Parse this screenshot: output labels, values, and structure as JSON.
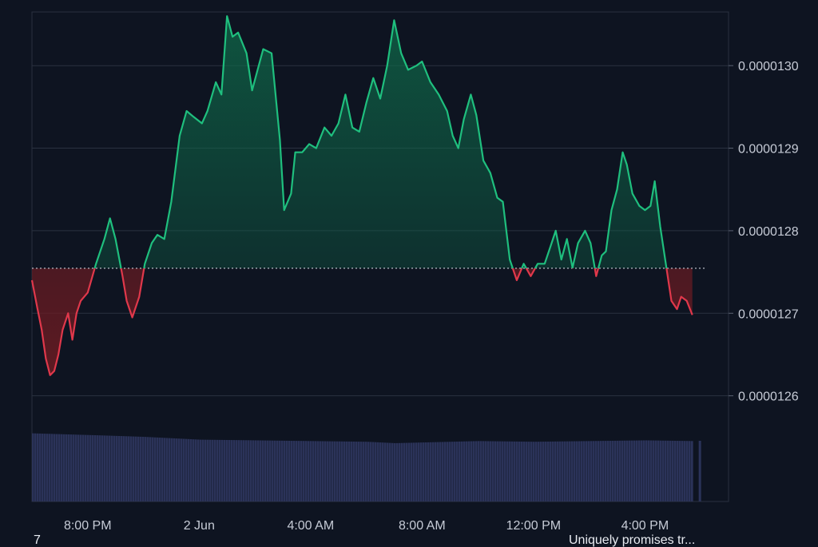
{
  "chart_data": {
    "type": "area",
    "baseline": 1.27545e-06,
    "ylim": [
      1.256e-06,
      1.3065e-06
    ],
    "x_ticks": [
      "8:00 PM",
      "2 Jun",
      "4:00 AM",
      "8:00 AM",
      "12:00 PM",
      "4:00 PM"
    ],
    "x_tick_positions_hours": [
      2,
      6,
      10,
      14,
      18,
      22
    ],
    "x_range_hours": [
      0,
      25
    ],
    "y_ticks": [
      1.26e-06,
      1.27e-06,
      1.28e-06,
      1.29e-06,
      1.3e-06
    ],
    "y_tick_labels": [
      "0.0000126",
      "0.0000127",
      "0.0000128",
      "0.0000129",
      "0.0000130"
    ],
    "grid": true,
    "price_series": [
      [
        0.0,
        1.274e-06
      ],
      [
        0.2,
        1.2705e-06
      ],
      [
        0.35,
        1.268e-06
      ],
      [
        0.5,
        1.2645e-06
      ],
      [
        0.65,
        1.2625e-06
      ],
      [
        0.8,
        1.263e-06
      ],
      [
        0.95,
        1.265e-06
      ],
      [
        1.1,
        1.268e-06
      ],
      [
        1.3,
        1.27e-06
      ],
      [
        1.45,
        1.2668e-06
      ],
      [
        1.6,
        1.27e-06
      ],
      [
        1.75,
        1.2715e-06
      ],
      [
        2.0,
        1.2725e-06
      ],
      [
        2.3,
        1.276e-06
      ],
      [
        2.6,
        1.279e-06
      ],
      [
        2.8,
        1.2815e-06
      ],
      [
        3.0,
        1.279e-06
      ],
      [
        3.25,
        1.2745e-06
      ],
      [
        3.4,
        1.2715e-06
      ],
      [
        3.6,
        1.2695e-06
      ],
      [
        3.85,
        1.272e-06
      ],
      [
        4.05,
        1.276e-06
      ],
      [
        4.3,
        1.2785e-06
      ],
      [
        4.5,
        1.2795e-06
      ],
      [
        4.75,
        1.279e-06
      ],
      [
        5.0,
        1.2835e-06
      ],
      [
        5.3,
        1.2915e-06
      ],
      [
        5.55,
        1.2945e-06
      ],
      [
        5.8,
        1.2938e-06
      ],
      [
        6.1,
        1.293e-06
      ],
      [
        6.3,
        1.2945e-06
      ],
      [
        6.6,
        1.298e-06
      ],
      [
        6.8,
        1.2965e-06
      ],
      [
        7.0,
        1.306e-06
      ],
      [
        7.2,
        1.3035e-06
      ],
      [
        7.4,
        1.304e-06
      ],
      [
        7.7,
        1.3015e-06
      ],
      [
        7.9,
        1.297e-06
      ],
      [
        8.1,
        1.2995e-06
      ],
      [
        8.3,
        1.302e-06
      ],
      [
        8.6,
        1.3015e-06
      ],
      [
        8.9,
        1.291e-06
      ],
      [
        9.05,
        1.2825e-06
      ],
      [
        9.3,
        1.2845e-06
      ],
      [
        9.45,
        1.2895e-06
      ],
      [
        9.7,
        1.2895e-06
      ],
      [
        9.95,
        1.2905e-06
      ],
      [
        10.2,
        1.29e-06
      ],
      [
        10.5,
        1.2925e-06
      ],
      [
        10.75,
        1.2915e-06
      ],
      [
        11.0,
        1.293e-06
      ],
      [
        11.25,
        1.2965e-06
      ],
      [
        11.5,
        1.2925e-06
      ],
      [
        11.75,
        1.292e-06
      ],
      [
        12.0,
        1.2955e-06
      ],
      [
        12.25,
        1.2985e-06
      ],
      [
        12.5,
        1.296e-06
      ],
      [
        12.75,
        1.3e-06
      ],
      [
        13.0,
        1.3055e-06
      ],
      [
        13.25,
        1.3015e-06
      ],
      [
        13.5,
        1.2995e-06
      ],
      [
        13.8,
        1.3e-06
      ],
      [
        14.0,
        1.3005e-06
      ],
      [
        14.3,
        1.298e-06
      ],
      [
        14.6,
        1.2965e-06
      ],
      [
        14.9,
        1.2945e-06
      ],
      [
        15.1,
        1.2915e-06
      ],
      [
        15.3,
        1.29e-06
      ],
      [
        15.5,
        1.2935e-06
      ],
      [
        15.75,
        1.2965e-06
      ],
      [
        15.95,
        1.294e-06
      ],
      [
        16.2,
        1.2885e-06
      ],
      [
        16.45,
        1.287e-06
      ],
      [
        16.7,
        1.284e-06
      ],
      [
        16.9,
        1.2835e-06
      ],
      [
        17.15,
        1.2765e-06
      ],
      [
        17.4,
        1.274e-06
      ],
      [
        17.65,
        1.276e-06
      ],
      [
        17.9,
        1.2745e-06
      ],
      [
        18.15,
        1.276e-06
      ],
      [
        18.4,
        1.276e-06
      ],
      [
        18.6,
        1.278e-06
      ],
      [
        18.8,
        1.28e-06
      ],
      [
        19.0,
        1.2765e-06
      ],
      [
        19.2,
        1.279e-06
      ],
      [
        19.4,
        1.2755e-06
      ],
      [
        19.6,
        1.2785e-06
      ],
      [
        19.85,
        1.28e-06
      ],
      [
        20.05,
        1.2785e-06
      ],
      [
        20.25,
        1.2745e-06
      ],
      [
        20.45,
        1.277e-06
      ],
      [
        20.6,
        1.2775e-06
      ],
      [
        20.8,
        1.2825e-06
      ],
      [
        21.0,
        1.285e-06
      ],
      [
        21.2,
        1.2895e-06
      ],
      [
        21.35,
        1.288e-06
      ],
      [
        21.55,
        1.2845e-06
      ],
      [
        21.8,
        1.283e-06
      ],
      [
        22.0,
        1.2825e-06
      ],
      [
        22.2,
        1.283e-06
      ],
      [
        22.35,
        1.286e-06
      ],
      [
        22.55,
        1.2805e-06
      ],
      [
        22.75,
        1.276e-06
      ],
      [
        22.95,
        1.2715e-06
      ],
      [
        23.15,
        1.2705e-06
      ],
      [
        23.3,
        1.272e-06
      ],
      [
        23.5,
        1.2715e-06
      ],
      [
        23.7,
        1.2698e-06
      ]
    ],
    "volume_series": [
      [
        0.0,
        0.97
      ],
      [
        2.5,
        0.94
      ],
      [
        4.0,
        0.92
      ],
      [
        6.0,
        0.88
      ],
      [
        8.0,
        0.87
      ],
      [
        10.0,
        0.86
      ],
      [
        12.0,
        0.85
      ],
      [
        13.0,
        0.83
      ],
      [
        14.0,
        0.84
      ],
      [
        16.0,
        0.86
      ],
      [
        18.0,
        0.85
      ],
      [
        20.0,
        0.86
      ],
      [
        22.0,
        0.87
      ],
      [
        23.7,
        0.86
      ]
    ]
  },
  "colors": {
    "up": "#1fbf7e",
    "down": "#e0384b",
    "up_fill": "#0f6a4a",
    "down_fill": "#6b1b22",
    "grid": "#2a3140",
    "volume": "#2b3359",
    "baseline": "#c8ccd6"
  },
  "footer": {
    "left_text": "7",
    "right_text": "Uniquely promises tr..."
  }
}
